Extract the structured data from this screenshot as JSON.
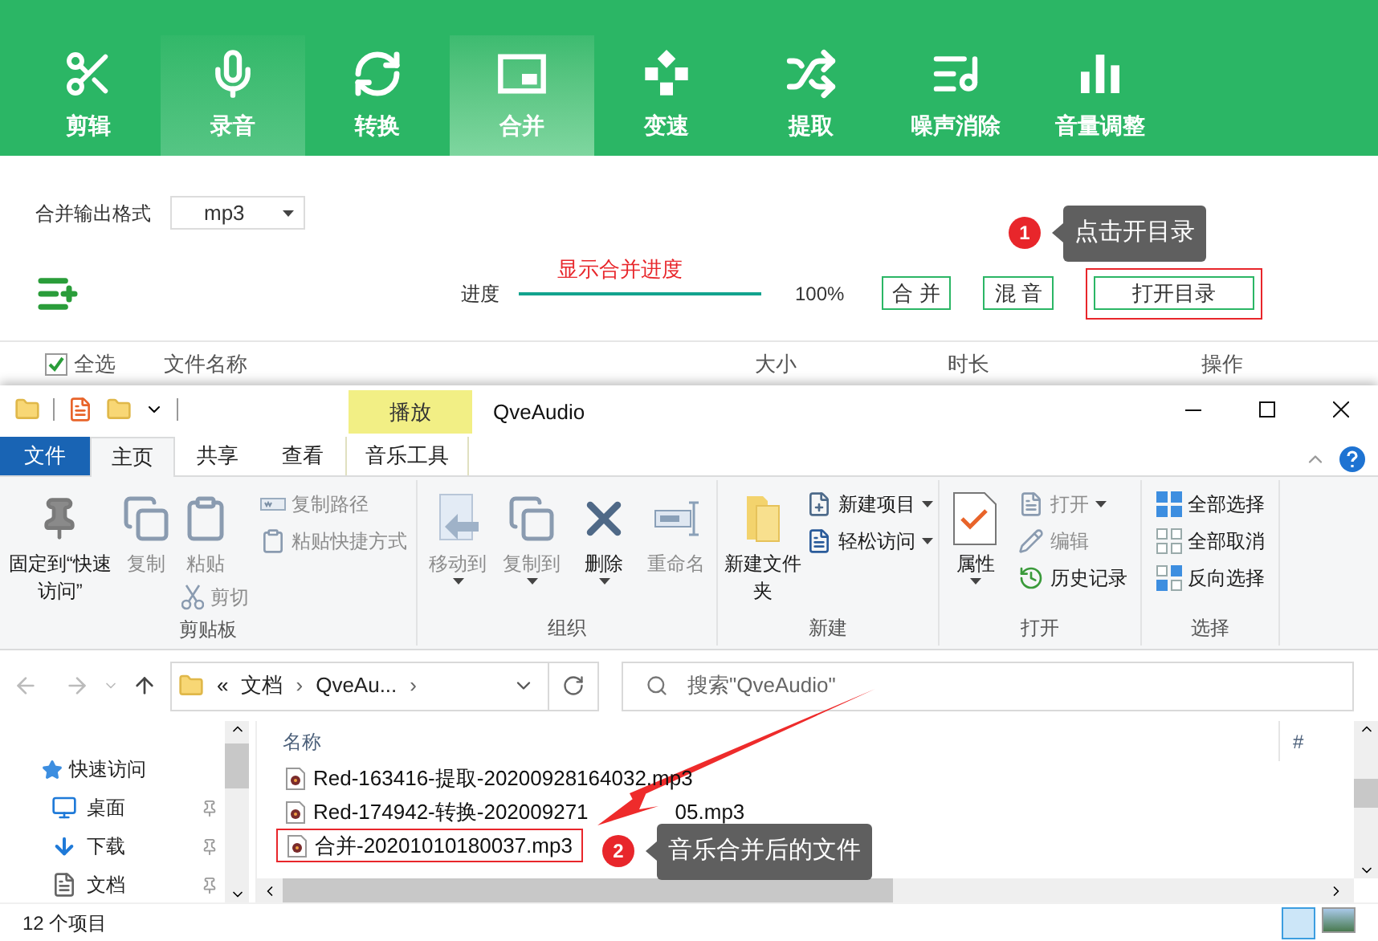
{
  "app": {
    "toolbar": [
      {
        "label": "剪辑",
        "selected": false,
        "hovered": false
      },
      {
        "label": "录音",
        "selected": false,
        "hovered": true
      },
      {
        "label": "转换",
        "selected": false,
        "hovered": false
      },
      {
        "label": "合并",
        "selected": true,
        "hovered": false
      },
      {
        "label": "变速",
        "selected": false,
        "hovered": false
      },
      {
        "label": "提取",
        "selected": false,
        "hovered": false
      },
      {
        "label": "噪声消除",
        "selected": false,
        "hovered": false
      },
      {
        "label": "音量调整",
        "selected": false,
        "hovered": false
      }
    ],
    "format": {
      "label": "合并输出格式",
      "value": "mp3"
    },
    "progress": {
      "label": "进度",
      "caption": "显示合并进度",
      "level": 1,
      "reading": "100%"
    },
    "buttons": [
      {
        "label": "合 并",
        "highlighted": false
      },
      {
        "label": "混 音",
        "highlighted": false
      },
      {
        "label": "打开目录",
        "highlighted": true
      }
    ],
    "callout": {
      "number": "1",
      "text": "点击开目录"
    },
    "table": {
      "select_all": {
        "label": "全选",
        "checked": true
      },
      "columns": [
        "文件名称",
        "大小",
        "时长",
        "操作"
      ]
    }
  },
  "explorer": {
    "context_tab": "播放",
    "title": "QveAudio",
    "tabs": [
      {
        "label": "文件",
        "kind": "file",
        "selected": false
      },
      {
        "label": "主页",
        "kind": "tab",
        "selected": true
      },
      {
        "label": "共享",
        "kind": "tab",
        "selected": false
      },
      {
        "label": "查看",
        "kind": "tab",
        "selected": false
      },
      {
        "label": "音乐工具",
        "kind": "context",
        "selected": false
      }
    ],
    "ribbon": [
      {
        "label": "剪贴板",
        "columns": [
          [
            {
              "kind": "large",
              "label": "固定到“快速访问”",
              "disabled": false,
              "dropdown": false
            }
          ],
          [
            {
              "kind": "large",
              "label": "复制",
              "disabled": true,
              "dropdown": false
            }
          ],
          [
            {
              "kind": "large",
              "label": "粘贴",
              "disabled": true,
              "dropdown": false
            },
            {
              "kind": "small",
              "label": "剪切",
              "disabled": true,
              "dropdown": false
            }
          ],
          [
            {
              "kind": "small",
              "label": "复制路径",
              "disabled": true,
              "dropdown": false
            },
            {
              "kind": "small",
              "label": "粘贴快捷方式",
              "disabled": true,
              "dropdown": false
            }
          ]
        ]
      },
      {
        "label": "组织",
        "columns": [
          [
            {
              "kind": "large",
              "label": "移动到",
              "disabled": true,
              "dropdown": true
            }
          ],
          [
            {
              "kind": "large",
              "label": "复制到",
              "disabled": true,
              "dropdown": true
            }
          ],
          [
            {
              "kind": "large",
              "label": "删除",
              "disabled": false,
              "dropdown": true
            }
          ],
          [
            {
              "kind": "large",
              "label": "重命名",
              "disabled": true,
              "dropdown": false
            }
          ]
        ]
      },
      {
        "label": "新建",
        "columns": [
          [
            {
              "kind": "large",
              "label": "新建文件夹",
              "disabled": false,
              "dropdown": false
            }
          ],
          [
            {
              "kind": "small",
              "label": "新建项目",
              "disabled": false,
              "dropdown": true
            },
            {
              "kind": "small",
              "label": "轻松访问",
              "disabled": false,
              "dropdown": true
            }
          ]
        ]
      },
      {
        "label": "打开",
        "columns": [
          [
            {
              "kind": "large",
              "label": "属性",
              "disabled": false,
              "dropdown": true
            }
          ],
          [
            {
              "kind": "small",
              "label": "打开",
              "disabled": true,
              "dropdown": true
            },
            {
              "kind": "small",
              "label": "编辑",
              "disabled": true,
              "dropdown": false
            },
            {
              "kind": "small",
              "label": "历史记录",
              "disabled": false,
              "dropdown": false
            }
          ]
        ]
      },
      {
        "label": "选择",
        "columns": [
          [
            {
              "kind": "small",
              "label": "全部选择",
              "disabled": false,
              "dropdown": false
            },
            {
              "kind": "small",
              "label": "全部取消",
              "disabled": false,
              "dropdown": false
            },
            {
              "kind": "small",
              "label": "反向选择",
              "disabled": false,
              "dropdown": false
            }
          ]
        ]
      }
    ],
    "breadcrumb": [
      "«",
      "文档",
      "›",
      "QveAu...",
      "›"
    ],
    "search": {
      "placeholder": "搜索\"QveAudio\""
    },
    "nav": [
      {
        "label": "快速访问",
        "children": [
          {
            "label": "桌面",
            "pinned": true
          },
          {
            "label": "下载",
            "pinned": true
          },
          {
            "label": "文档",
            "pinned": true
          }
        ]
      }
    ],
    "columns": [
      "名称",
      "#"
    ],
    "files": [
      {
        "name": "Red-163416-提取-20200928164032.mp3",
        "highlighted": false
      },
      {
        "name": "Red-174942-转换-202009271",
        "name_end": "05.mp3",
        "highlighted": false
      },
      {
        "name": "合并-20201010180037.mp3",
        "highlighted": true
      }
    ],
    "callout": {
      "number": "2",
      "text": "音乐合并后的文件"
    },
    "status": "12 个项目"
  }
}
